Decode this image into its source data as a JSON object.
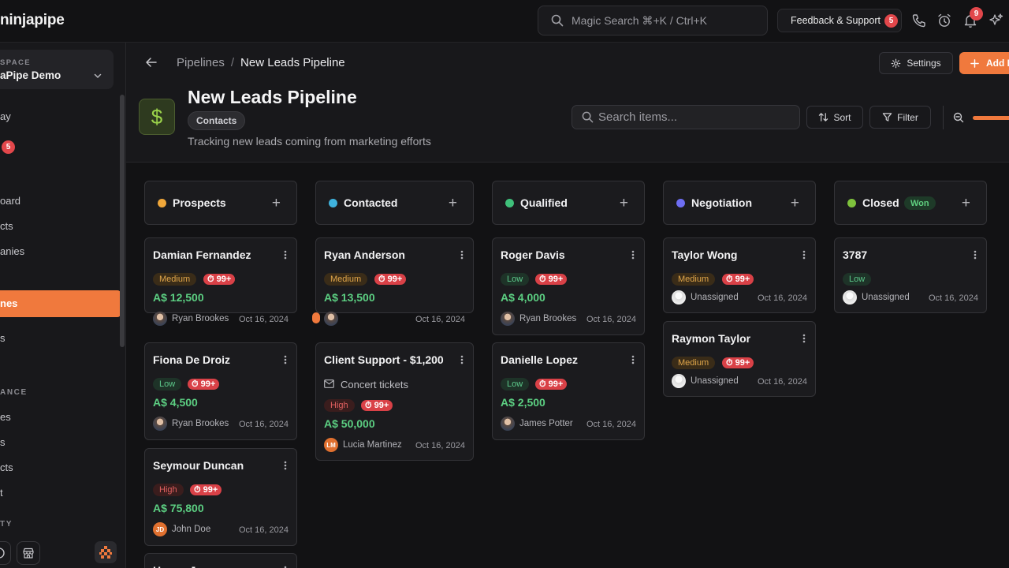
{
  "topbar": {
    "logo": "ninjapipe",
    "magic_search": "Magic Search ⌘+K / Ctrl+K",
    "feedback": "Feedback & Support",
    "feedback_count": "5",
    "bell_count": "9"
  },
  "sidebar": {
    "workspace_label": "SPACE",
    "workspace_name": "aPipe Demo",
    "items": [
      {
        "label": "ay"
      },
      {
        "label": "5"
      },
      {
        "label": "oard"
      },
      {
        "label": "cts"
      },
      {
        "label": "anies"
      },
      {
        "label": "nes"
      },
      {
        "label": "s"
      },
      {
        "label": "es"
      },
      {
        "label": "s"
      },
      {
        "label": "cts"
      },
      {
        "label": "t"
      }
    ],
    "section_finance": "ANCE",
    "section_activity": "TY"
  },
  "header": {
    "breadcrumb_root": "Pipelines",
    "breadcrumb_sep": "/",
    "breadcrumb_current": "New Leads Pipeline",
    "settings_label": "Settings",
    "add_label": "Add I",
    "title": "New Leads Pipeline",
    "tag": "Contacts",
    "description": "Tracking new leads coming from marketing efforts",
    "search_placeholder": "Search items...",
    "sort_label": "Sort",
    "filter_label": "Filter",
    "icon_symbol": "$"
  },
  "columns": [
    {
      "name": "Prospects",
      "color": "#f0a73a"
    },
    {
      "name": "Contacted",
      "color": "#3fb3de"
    },
    {
      "name": "Qualified",
      "color": "#3fc07a"
    },
    {
      "name": "Negotiation",
      "color": "#6d6df2"
    },
    {
      "name": "Closed",
      "color": "#7ec23c",
      "badge": "Won"
    }
  ],
  "cards": {
    "prospects": [
      {
        "title": "Damian Fernandez",
        "priority": "Medium",
        "count": "99+",
        "amount": "A$ 12,500",
        "owner": "Ryan Brookes",
        "date": "Oct 16, 2024"
      },
      {
        "title": "Fiona De Droiz",
        "priority": "Low",
        "count": "99+",
        "amount": "A$ 4,500",
        "owner": "Ryan Brookes",
        "date": "Oct 16, 2024"
      },
      {
        "title": "Seymour Duncan",
        "priority": "High",
        "count": "99+",
        "amount": "A$ 75,800",
        "owner": "John Doe",
        "owner_initials": "JD",
        "date": "Oct 16, 2024"
      },
      {
        "title": "Hanna Jay"
      }
    ],
    "contacted": [
      {
        "title": "Ryan Anderson",
        "priority": "Medium",
        "count": "99+",
        "amount": "A$ 13,500",
        "owner": "",
        "date": "Oct 16, 2024"
      },
      {
        "title": "Client Support - $1,200",
        "subtitle": "Concert tickets",
        "priority": "High",
        "count": "99+",
        "amount": "A$ 50,000",
        "owner": "Lucia Martinez",
        "owner_initials": "LM",
        "date": "Oct 16, 2024"
      }
    ],
    "qualified": [
      {
        "title": "Roger Davis",
        "priority": "Low",
        "count": "99+",
        "amount": "A$ 4,000",
        "owner": "Ryan Brookes",
        "date": "Oct 16, 2024"
      },
      {
        "title": "Danielle Lopez",
        "priority": "Low",
        "count": "99+",
        "amount": "A$ 2,500",
        "owner": "James Potter",
        "date": "Oct 16, 2024"
      }
    ],
    "negotiation": [
      {
        "title": "Taylor Wong",
        "priority": "Medium",
        "count": "99+",
        "owner": "Unassigned",
        "date": "Oct 16, 2024"
      },
      {
        "title": "Raymon Taylor",
        "priority": "Medium",
        "count": "99+",
        "owner": "Unassigned",
        "date": "Oct 16, 2024"
      }
    ],
    "closed": [
      {
        "title": "3787",
        "priority": "Low",
        "owner": "Unassigned",
        "date": "Oct 16, 2024"
      }
    ]
  }
}
